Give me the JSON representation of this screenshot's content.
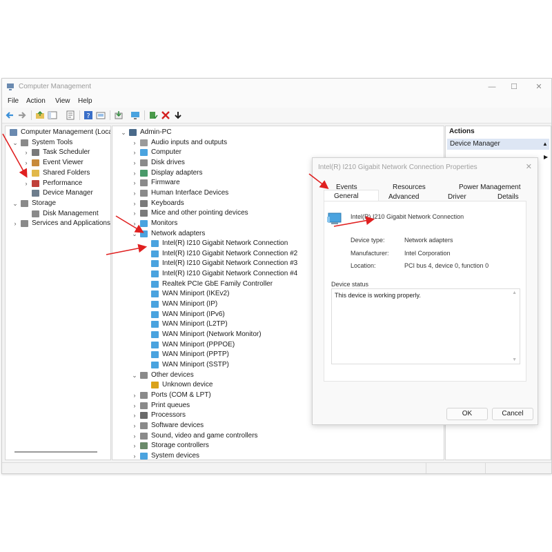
{
  "window": {
    "title": "Computer Management",
    "minimize_icon": "—",
    "maximize_icon": "☐",
    "close_icon": "✕"
  },
  "menu": [
    "File",
    "Action",
    "View",
    "Help"
  ],
  "left_tree": [
    {
      "label": "Computer Management (Local",
      "indent": 0,
      "chev": "",
      "icon": "computer-management-icon",
      "color": "#6a8ab0"
    },
    {
      "label": "System Tools",
      "indent": 1,
      "chev": "⌄",
      "icon": "tools-icon",
      "color": "#8a8a8a"
    },
    {
      "label": "Task Scheduler",
      "indent": 2,
      "chev": "›",
      "icon": "clock-icon",
      "color": "#7a7a7a"
    },
    {
      "label": "Event Viewer",
      "indent": 2,
      "chev": "›",
      "icon": "event-viewer-icon",
      "color": "#c88a3a"
    },
    {
      "label": "Shared Folders",
      "indent": 2,
      "chev": "›",
      "icon": "shared-folder-icon",
      "color": "#e1b84a"
    },
    {
      "label": "Performance",
      "indent": 2,
      "chev": "›",
      "icon": "performance-icon",
      "color": "#c0403a"
    },
    {
      "label": "Device Manager",
      "indent": 2,
      "chev": "",
      "icon": "device-manager-icon",
      "color": "#6d7d8c"
    },
    {
      "label": "Storage",
      "indent": 1,
      "chev": "⌄",
      "icon": "storage-icon",
      "color": "#8a8a8a"
    },
    {
      "label": "Disk Management",
      "indent": 2,
      "chev": "",
      "icon": "disk-icon",
      "color": "#8a8a8a"
    },
    {
      "label": "Services and Applications",
      "indent": 1,
      "chev": "›",
      "icon": "services-icon",
      "color": "#8a8a8a"
    }
  ],
  "device_tree": [
    {
      "label": "Admin-PC",
      "indent": 0,
      "chev": "⌄",
      "icon": "pc-icon",
      "color": "#4a6a8a"
    },
    {
      "label": "Audio inputs and outputs",
      "indent": 1,
      "chev": "›",
      "icon": "audio-icon",
      "color": "#9a9a9a"
    },
    {
      "label": "Computer",
      "indent": 1,
      "chev": "›",
      "icon": "computer-icon",
      "color": "#4aa3df"
    },
    {
      "label": "Disk drives",
      "indent": 1,
      "chev": "›",
      "icon": "disk-drive-icon",
      "color": "#8a8a8a"
    },
    {
      "label": "Display adapters",
      "indent": 1,
      "chev": "›",
      "icon": "display-adapter-icon",
      "color": "#4a9a6a"
    },
    {
      "label": "Firmware",
      "indent": 1,
      "chev": "›",
      "icon": "firmware-icon",
      "color": "#8a8a8a"
    },
    {
      "label": "Human Interface Devices",
      "indent": 1,
      "chev": "›",
      "icon": "hid-icon",
      "color": "#8a8a8a"
    },
    {
      "label": "Keyboards",
      "indent": 1,
      "chev": "›",
      "icon": "keyboard-icon",
      "color": "#7a7a7a"
    },
    {
      "label": "Mice and other pointing devices",
      "indent": 1,
      "chev": "›",
      "icon": "mouse-icon",
      "color": "#7a7a7a"
    },
    {
      "label": "Monitors",
      "indent": 1,
      "chev": "›",
      "icon": "monitor-icon",
      "color": "#4aa3df"
    },
    {
      "label": "Network adapters",
      "indent": 1,
      "chev": "⌄",
      "icon": "network-adapter-icon",
      "color": "#4aa3df"
    },
    {
      "label": "Intel(R) I210 Gigabit Network Connection",
      "indent": 2,
      "chev": "",
      "icon": "network-adapter-icon",
      "color": "#4aa3df"
    },
    {
      "label": "Intel(R) I210 Gigabit Network Connection #2",
      "indent": 2,
      "chev": "",
      "icon": "network-adapter-icon",
      "color": "#4aa3df"
    },
    {
      "label": "Intel(R) I210 Gigabit Network Connection #3",
      "indent": 2,
      "chev": "",
      "icon": "network-adapter-icon",
      "color": "#4aa3df"
    },
    {
      "label": "Intel(R) I210 Gigabit Network Connection #4",
      "indent": 2,
      "chev": "",
      "icon": "network-adapter-icon",
      "color": "#4aa3df"
    },
    {
      "label": "Realtek PCIe GbE Family Controller",
      "indent": 2,
      "chev": "",
      "icon": "network-adapter-icon",
      "color": "#4aa3df"
    },
    {
      "label": "WAN Miniport (IKEv2)",
      "indent": 2,
      "chev": "",
      "icon": "network-adapter-icon",
      "color": "#4aa3df"
    },
    {
      "label": "WAN Miniport (IP)",
      "indent": 2,
      "chev": "",
      "icon": "network-adapter-icon",
      "color": "#4aa3df"
    },
    {
      "label": "WAN Miniport (IPv6)",
      "indent": 2,
      "chev": "",
      "icon": "network-adapter-icon",
      "color": "#4aa3df"
    },
    {
      "label": "WAN Miniport (L2TP)",
      "indent": 2,
      "chev": "",
      "icon": "network-adapter-icon",
      "color": "#4aa3df"
    },
    {
      "label": "WAN Miniport (Network Monitor)",
      "indent": 2,
      "chev": "",
      "icon": "network-adapter-icon",
      "color": "#4aa3df"
    },
    {
      "label": "WAN Miniport (PPPOE)",
      "indent": 2,
      "chev": "",
      "icon": "network-adapter-icon",
      "color": "#4aa3df"
    },
    {
      "label": "WAN Miniport (PPTP)",
      "indent": 2,
      "chev": "",
      "icon": "network-adapter-icon",
      "color": "#4aa3df"
    },
    {
      "label": "WAN Miniport (SSTP)",
      "indent": 2,
      "chev": "",
      "icon": "network-adapter-icon",
      "color": "#4aa3df"
    },
    {
      "label": "Other devices",
      "indent": 1,
      "chev": "⌄",
      "icon": "other-devices-icon",
      "color": "#8a8a8a"
    },
    {
      "label": "Unknown device",
      "indent": 2,
      "chev": "",
      "icon": "warning-icon",
      "color": "#d9a21b"
    },
    {
      "label": "Ports (COM & LPT)",
      "indent": 1,
      "chev": "›",
      "icon": "port-icon",
      "color": "#8a8a8a"
    },
    {
      "label": "Print queues",
      "indent": 1,
      "chev": "›",
      "icon": "printer-icon",
      "color": "#8a8a8a"
    },
    {
      "label": "Processors",
      "indent": 1,
      "chev": "›",
      "icon": "processor-icon",
      "color": "#6a6a6a"
    },
    {
      "label": "Software devices",
      "indent": 1,
      "chev": "›",
      "icon": "software-device-icon",
      "color": "#8a8a8a"
    },
    {
      "label": "Sound, video and game controllers",
      "indent": 1,
      "chev": "›",
      "icon": "sound-icon",
      "color": "#8a8a8a"
    },
    {
      "label": "Storage controllers",
      "indent": 1,
      "chev": "›",
      "icon": "storage-controller-icon",
      "color": "#6a8a6a"
    },
    {
      "label": "System devices",
      "indent": 1,
      "chev": "›",
      "icon": "system-devices-icon",
      "color": "#4aa3df"
    }
  ],
  "actions": {
    "header": "Actions",
    "item": "Device Manager"
  },
  "dialog": {
    "title": "Intel(R) I210 Gigabit Network Connection Properties",
    "tabs_row1": [
      "Events",
      "Resources",
      "Power Management"
    ],
    "tabs_row2": [
      "General",
      "Advanced",
      "Driver",
      "Details"
    ],
    "device_name": "Intel(R) I210 Gigabit Network Connection",
    "device_type_label": "Device type:",
    "device_type_value": "Network adapters",
    "manufacturer_label": "Manufacturer:",
    "manufacturer_value": "Intel Corporation",
    "location_label": "Location:",
    "location_value": "PCI bus 4, device 0, function 0",
    "status_label": "Device status",
    "status_text": "This device is working properly.",
    "ok_label": "OK",
    "cancel_label": "Cancel"
  },
  "colors": {
    "annotation_arrow": "#e02020",
    "selection": "#dde6f4"
  }
}
